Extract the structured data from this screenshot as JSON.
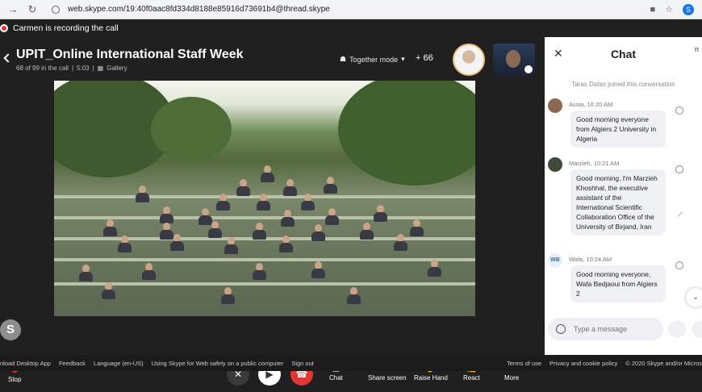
{
  "browser": {
    "url": "web.skype.com/19:40f0aac8fd334d8188e85916d73691b4@thread.skype"
  },
  "recording": {
    "text": "Carmen is recording the call"
  },
  "call": {
    "title": "UPIT_Online International Staff Week",
    "in_call": "68 of 99 in the call",
    "duration": "5:03",
    "view": "Gallery",
    "mode": "Together mode",
    "extra_count": "+ 66"
  },
  "self_initial": "S",
  "controls": {
    "stop": "Stop",
    "chat": "Chat",
    "share": "Share screen",
    "raise_hand": "Raise Hand",
    "react": "React",
    "more": "More"
  },
  "chat": {
    "title": "Chat",
    "system_message": "Taras Datso joined this conversation",
    "messages": [
      {
        "sender": "Assia",
        "time": "10:20 AM",
        "text": "Good morning everyone from Algiers 2 University in Algeria"
      },
      {
        "sender": "Marzieh",
        "time": "10:21 AM",
        "text": "Good morning, I'm Marzieh Khoshhal, the executive assistant of the International Scientific Collaboration Office of the University of Birjand, Iran"
      },
      {
        "sender": "Wafa",
        "time": "10:24 AM",
        "initials": "WB",
        "text": "Good morning everyone, Wafa Bedjaoui from Algiers 2"
      }
    ],
    "input_placeholder": "Type a message"
  },
  "footer": {
    "left": [
      "nload Desktop App",
      "Feedback",
      "Language (en-US)",
      "Using Skype for Web safely on a public computer",
      "Sign out"
    ],
    "right": [
      "Terms of use",
      "Privacy and cookie policy",
      "© 2020 Skype and/or Micros"
    ]
  },
  "colors": {
    "record_red": "#e23535",
    "end_call_red": "#e23535",
    "chat_bg": "#ffffff"
  }
}
